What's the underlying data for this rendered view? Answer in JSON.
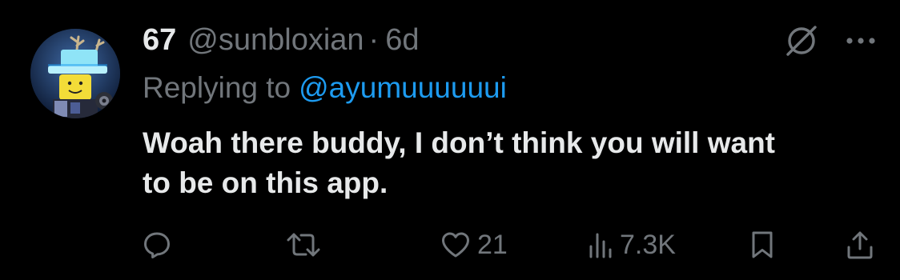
{
  "tweet": {
    "display_name": "67",
    "handle": "@sunbloxian",
    "separator": "·",
    "timestamp": "6d",
    "replying_prefix": "Replying to",
    "replying_to": "@ayumuuuuuui",
    "text_lines": [
      "Woah there buddy, I don’t think you will want",
      "to be on this app."
    ]
  },
  "actions": {
    "reply": {
      "icon": "reply-icon"
    },
    "repost": {
      "icon": "repost-icon"
    },
    "like": {
      "icon": "heart-icon",
      "count": "21"
    },
    "views": {
      "icon": "views-icon",
      "count": "7.3K"
    },
    "bookmark": {
      "icon": "bookmark-icon"
    },
    "share": {
      "icon": "share-icon"
    }
  },
  "header_icons": {
    "grok": "grok-icon",
    "more": "more-icon"
  },
  "colors": {
    "background": "#000000",
    "primary_text": "#e7e9ea",
    "secondary_text": "#71767b",
    "accent": "#1d9bf0"
  }
}
